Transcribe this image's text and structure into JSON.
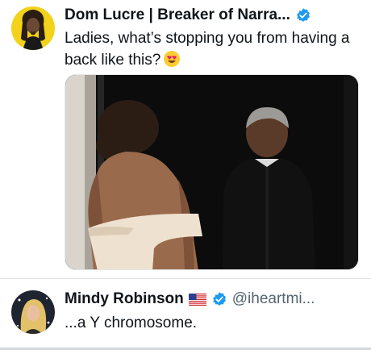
{
  "posts": [
    {
      "author_name": "Dom Lucre | Breaker of Narra...",
      "verified": true,
      "text": "Ladies, what’s stopping you from having a back like this?",
      "emoji": "heart-eyes-emoji",
      "has_image": true
    },
    {
      "author_name": "Mindy Robinson",
      "flag": "us-flag",
      "verified": true,
      "handle": "@iheartmi...",
      "text": "...a Y chromosome."
    }
  ],
  "colors": {
    "verified_blue": "#1d9bf0",
    "text_primary": "#0f1419",
    "text_secondary": "#536471",
    "avatar1_bg": "#f2d21b"
  }
}
